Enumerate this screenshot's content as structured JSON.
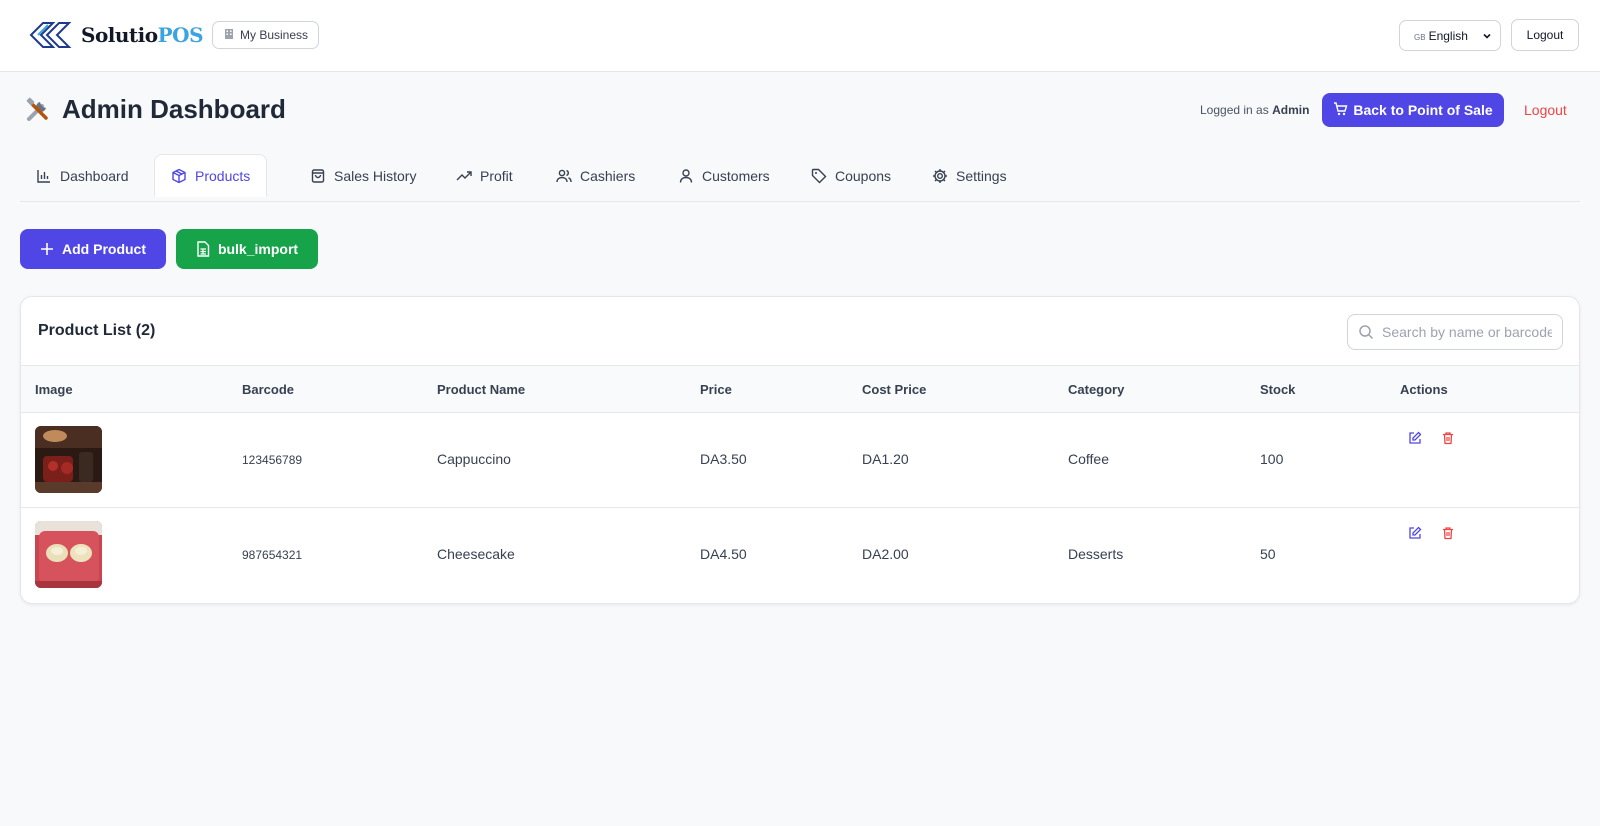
{
  "brand": {
    "name_main": "Solutio",
    "name_accent": "POS"
  },
  "topbar": {
    "business_label": "My Business",
    "language": {
      "flag": "GB",
      "selected": "English"
    },
    "logout_label": "Logout"
  },
  "header": {
    "title": "Admin Dashboard",
    "logged_in_prefix": "Logged in as",
    "logged_in_user": "Admin",
    "back_label": "Back to Point of Sale",
    "logout_label": "Logout"
  },
  "tabs": [
    {
      "label": "Dashboard",
      "icon": "bar-chart-icon"
    },
    {
      "label": "Products",
      "icon": "box-icon",
      "active": true
    },
    {
      "label": "Sales History",
      "icon": "shopping-bag-icon"
    },
    {
      "label": "Profit",
      "icon": "trending-up-icon"
    },
    {
      "label": "Cashiers",
      "icon": "users-icon"
    },
    {
      "label": "Customers",
      "icon": "user-icon"
    },
    {
      "label": "Coupons",
      "icon": "tag-icon"
    },
    {
      "label": "Settings",
      "icon": "gear-icon"
    }
  ],
  "actions": {
    "add_label": "Add Product",
    "import_label": "bulk_import"
  },
  "product_list": {
    "title": "Product List (2)",
    "search_placeholder": "Search by name or barcode",
    "columns": [
      "Image",
      "Barcode",
      "Product Name",
      "Price",
      "Cost Price",
      "Category",
      "Stock",
      "Actions"
    ],
    "rows": [
      {
        "barcode": "123456789",
        "name": "Cappuccino",
        "price": "DA3.50",
        "cost": "DA1.20",
        "category": "Coffee",
        "stock": "100"
      },
      {
        "barcode": "987654321",
        "name": "Cheesecake",
        "price": "DA4.50",
        "cost": "DA2.00",
        "category": "Desserts",
        "stock": "50"
      }
    ]
  },
  "colors": {
    "primary": "#4f46e5",
    "success": "#16a34a",
    "danger": "#ef4444",
    "brand_accent": "#3ba3e0"
  }
}
